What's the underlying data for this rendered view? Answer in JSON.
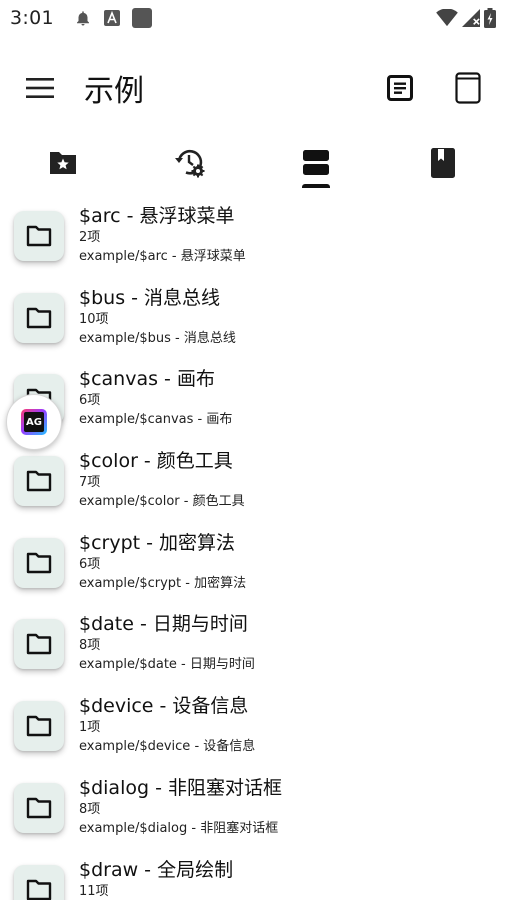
{
  "status_bar": {
    "time": "3:01",
    "icons": [
      "bell-icon",
      "text-a-icon",
      "square-icon",
      "wifi-icon",
      "signal-icon",
      "battery-icon"
    ]
  },
  "app_bar": {
    "title": "示例",
    "actions": [
      "document-icon",
      "tablet-icon"
    ]
  },
  "tabs": [
    {
      "icon": "folder-star-icon",
      "selected": false
    },
    {
      "icon": "history-settings-icon",
      "selected": false
    },
    {
      "icon": "storage-icon",
      "selected": true
    },
    {
      "icon": "book-icon",
      "selected": false
    }
  ],
  "items": [
    {
      "title": "$arc - 悬浮球菜单",
      "count": "2项",
      "path": "example/$arc - 悬浮球菜单"
    },
    {
      "title": "$bus - 消息总线",
      "count": "10项",
      "path": "example/$bus - 消息总线"
    },
    {
      "title": "$canvas - 画布",
      "count": "6项",
      "path": "example/$canvas - 画布"
    },
    {
      "title": "$color - 颜色工具",
      "count": "7项",
      "path": "example/$color - 颜色工具"
    },
    {
      "title": "$crypt - 加密算法",
      "count": "6项",
      "path": "example/$crypt - 加密算法"
    },
    {
      "title": "$date - 日期与时间",
      "count": "8项",
      "path": "example/$date - 日期与时间"
    },
    {
      "title": "$device - 设备信息",
      "count": "1项",
      "path": "example/$device - 设备信息"
    },
    {
      "title": "$dialog - 非阻塞对话框",
      "count": "8项",
      "path": "example/$dialog - 非阻塞对话框"
    },
    {
      "title": "$draw - 全局绘制",
      "count": "11项",
      "path": ""
    }
  ],
  "floating_ball": {
    "label": "AG"
  },
  "colors": {
    "folder_bg": "#e6efec",
    "text": "#111111",
    "background": "#ffffff"
  }
}
